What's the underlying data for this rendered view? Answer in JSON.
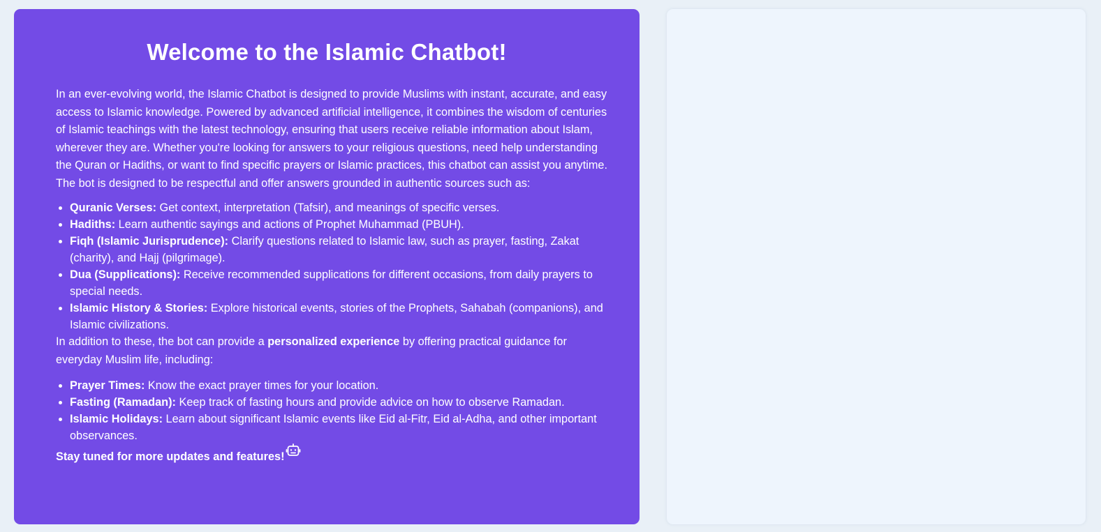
{
  "welcome": {
    "title": "Welcome to the Islamic Chatbot!",
    "intro": "In an ever-evolving world, the Islamic Chatbot is designed to provide Muslims with instant, accurate, and easy access to Islamic knowledge. Powered by advanced artificial intelligence, it combines the wisdom of centuries of Islamic teachings with the latest technology, ensuring that users receive reliable information about Islam, wherever they are. Whether you're looking for answers to your religious questions, need help understanding the Quran or Hadiths, or want to find specific prayers or Islamic practices, this chatbot can assist you anytime. The bot is designed to be respectful and offer answers grounded in authentic sources such as:",
    "features": [
      {
        "term": "Quranic Verses:",
        "desc": " Get context, interpretation (Tafsir), and meanings of specific verses."
      },
      {
        "term": "Hadiths:",
        "desc": " Learn authentic sayings and actions of Prophet Muhammad (PBUH)."
      },
      {
        "term": "Fiqh (Islamic Jurisprudence):",
        "desc": " Clarify questions related to Islamic law, such as prayer, fasting, Zakat (charity), and Hajj (pilgrimage)."
      },
      {
        "term": "Dua (Supplications):",
        "desc": " Receive recommended supplications for different occasions, from daily prayers to special needs."
      },
      {
        "term": "Islamic History & Stories:",
        "desc": " Explore historical events, stories of the Prophets, Sahabah (companions), and Islamic civilizations."
      }
    ],
    "para2_before": "In addition to these, the bot can provide a ",
    "para2_bold": "personalized experience",
    "para2_after": " by offering practical guidance for everyday Muslim life, including:",
    "guidance": [
      {
        "term": "Prayer Times:",
        "desc": " Know the exact prayer times for your location."
      },
      {
        "term": "Fasting (Ramadan):",
        "desc": " Keep track of fasting hours and provide advice on how to observe Ramadan."
      },
      {
        "term": "Islamic Holidays:",
        "desc": " Learn about significant Islamic events like Eid al-Fitr, Eid al-Adha, and other important observances."
      }
    ],
    "stay_tuned": "Stay tuned for more updates and features!",
    "stay_tuned_icon": "robot-icon"
  },
  "colors": {
    "card_background": "#734be6",
    "page_background": "#e9f0f7",
    "chat_panel_background": "#eef5fd",
    "text": "#ffffff"
  }
}
